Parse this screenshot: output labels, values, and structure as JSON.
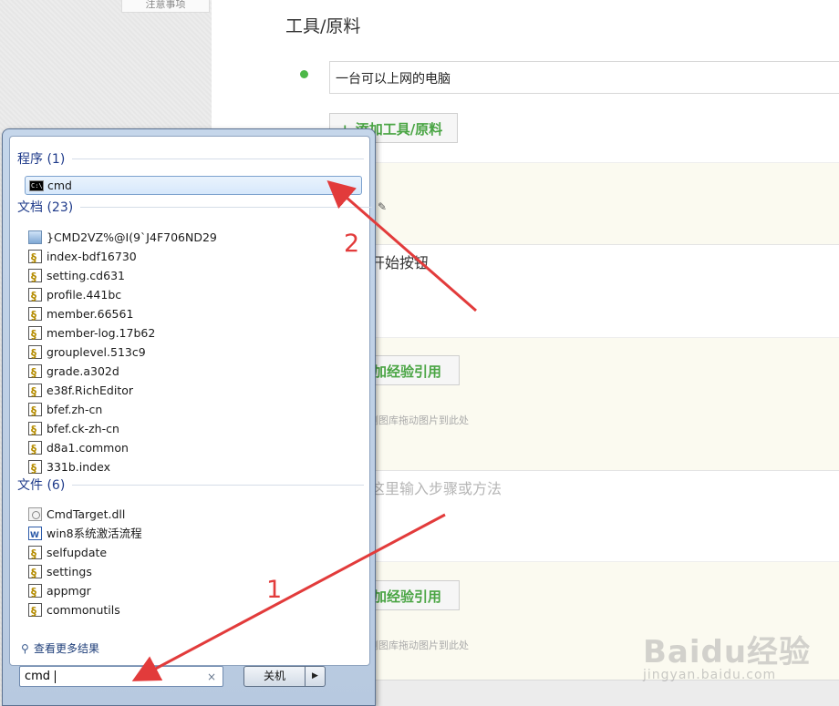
{
  "page": {
    "top_tab_label": "注意事项",
    "tools_title": "工具/原料",
    "tool_item_value": "一台可以上网的电脑",
    "add_tool_label": "+ 添加工具/原料",
    "step1_text": "开始按钮",
    "add_exp_label": "加经验引用",
    "drag_hint": "侧图库拖动图片到此处",
    "step_placeholder": "这里输入步骤或方法",
    "watermark": "Baidu经验",
    "watermark_sub": "jingyan.baidu.com",
    "accent_color": "#4cb848"
  },
  "start_menu": {
    "groups": [
      {
        "title": "程序 (1)",
        "items": [
          {
            "label": "cmd",
            "icon": "cmd-icon"
          }
        ]
      },
      {
        "title": "文档 (23)",
        "items": [
          {
            "label": "}CMD2VZ%@I(9`J4F706ND29",
            "icon": "image-file-icon"
          },
          {
            "label": "index-bdf16730",
            "icon": "script-file-icon"
          },
          {
            "label": "setting.cd631",
            "icon": "script-file-icon"
          },
          {
            "label": "profile.441bc",
            "icon": "script-file-icon"
          },
          {
            "label": "member.66561",
            "icon": "script-file-icon"
          },
          {
            "label": "member-log.17b62",
            "icon": "script-file-icon"
          },
          {
            "label": "grouplevel.513c9",
            "icon": "script-file-icon"
          },
          {
            "label": "grade.a302d",
            "icon": "script-file-icon"
          },
          {
            "label": "e38f.RichEditor",
            "icon": "script-file-icon"
          },
          {
            "label": "bfef.zh-cn",
            "icon": "script-file-icon"
          },
          {
            "label": "bfef.ck-zh-cn",
            "icon": "script-file-icon"
          },
          {
            "label": "d8a1.common",
            "icon": "script-file-icon"
          },
          {
            "label": "331b.index",
            "icon": "script-file-icon"
          }
        ]
      },
      {
        "title": "文件 (6)",
        "items": [
          {
            "label": "CmdTarget.dll",
            "icon": "dll-file-icon"
          },
          {
            "label": "win8系统激活流程",
            "icon": "word-file-icon"
          },
          {
            "label": "selfupdate",
            "icon": "script-file-icon"
          },
          {
            "label": "settings",
            "icon": "script-file-icon"
          },
          {
            "label": "appmgr",
            "icon": "script-file-icon"
          },
          {
            "label": "commonutils",
            "icon": "script-file-icon"
          }
        ]
      }
    ],
    "see_more": "查看更多结果",
    "search_value": "cmd",
    "clear_glyph": "×",
    "shutdown_label": "关机",
    "shutdown_arrow": "▶"
  },
  "annotations": {
    "label1": "1",
    "label2": "2",
    "color": "#e23b3b"
  }
}
